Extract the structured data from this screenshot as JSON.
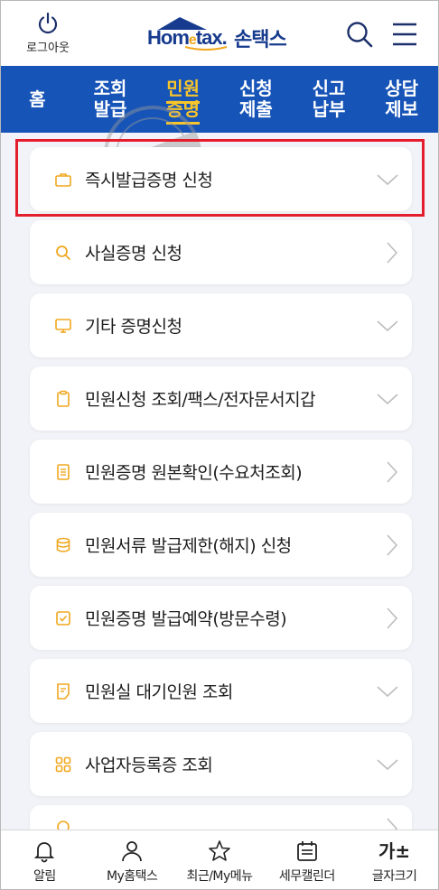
{
  "header": {
    "logout_label": "로그아웃",
    "brand_en_a": "Hom",
    "brand_en_b": "e",
    "brand_en_c": "tax.",
    "brand_ko": "손택스",
    "brand_color": "#173b8e"
  },
  "nav": {
    "color": "#1754b7",
    "active_color": "#f8c52a",
    "items": [
      {
        "label": "홈"
      },
      {
        "label": "조회\n발급"
      },
      {
        "label": "민원\n증명"
      },
      {
        "label": "신청\n제출"
      },
      {
        "label": "신고\n납부"
      },
      {
        "label": "상담\n제보"
      }
    ]
  },
  "list": {
    "items": [
      {
        "label": "즉시발급증명 신청",
        "icon": "briefcase-icon",
        "arrow": "chevron-down"
      },
      {
        "label": "사실증명 신청",
        "icon": "search-icon",
        "arrow": "chevron-right"
      },
      {
        "label": "기타 증명신청",
        "icon": "monitor-icon",
        "arrow": "chevron-down"
      },
      {
        "label": "민원신청 조회/팩스/전자문서지갑",
        "icon": "clipboard-icon",
        "arrow": "chevron-down"
      },
      {
        "label": "민원증명 원본확인(수요처조회)",
        "icon": "document-icon",
        "arrow": "chevron-right"
      },
      {
        "label": "민원서류 발급제한(해지) 신청",
        "icon": "database-icon",
        "arrow": "chevron-right"
      },
      {
        "label": "민원증명 발급예약(방문수령)",
        "icon": "check-box-icon",
        "arrow": "chevron-right"
      },
      {
        "label": "민원실 대기인원 조회",
        "icon": "note-icon",
        "arrow": "chevron-down"
      },
      {
        "label": "사업자등록증 조회",
        "icon": "grid-icon",
        "arrow": "chevron-down"
      },
      {
        "label": "",
        "icon": "partial-icon",
        "arrow": "chevron-right"
      }
    ],
    "icon_color": "#f0a71e"
  },
  "bottom": {
    "items": [
      {
        "label": "알림"
      },
      {
        "label": "My홈택스"
      },
      {
        "label": "최근/My메뉴"
      },
      {
        "label": "세무캘린더"
      },
      {
        "label": "글자크기",
        "glyph": "가±"
      }
    ]
  }
}
